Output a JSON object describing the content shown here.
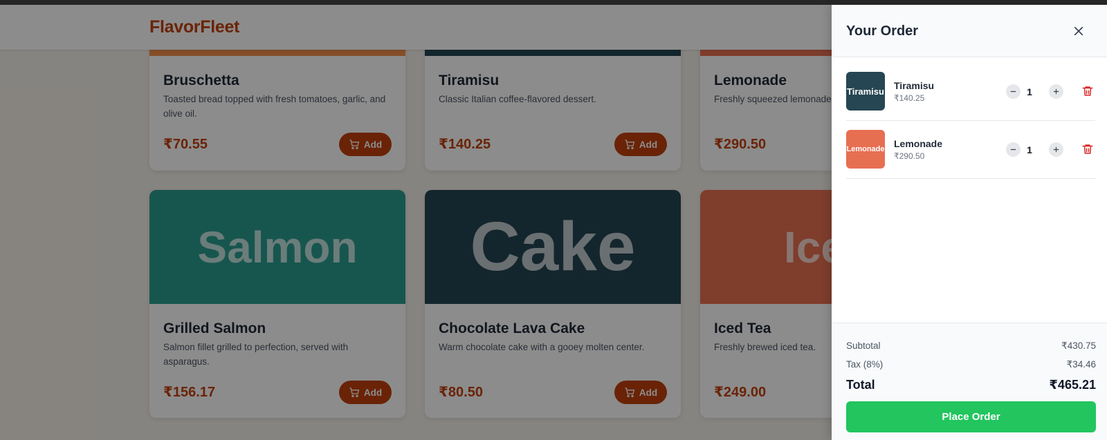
{
  "app": {
    "brand": "FlavorFleet"
  },
  "menu": {
    "add_label": "Add",
    "items": [
      {
        "name": "Bruschetta",
        "description": "Toasted bread topped with fresh tomatoes, garlic, and olive oil.",
        "price": "₹70.55",
        "image_color": "#f0904a"
      },
      {
        "name": "Tiramisu",
        "description": "Classic Italian coffee-flavored dessert.",
        "price": "₹140.25",
        "image_color": "#264653"
      },
      {
        "name": "Lemonade",
        "description": "Freshly squeezed lemonade.",
        "price": "₹290.50",
        "image_color": "#e76f51"
      },
      {
        "name": "Grilled Salmon",
        "description": "Salmon fillet grilled to perfection, served with asparagus.",
        "price": "₹156.17",
        "image_text": "Salmon",
        "image_color": "#2a9d8f"
      },
      {
        "name": "Chocolate Lava Cake",
        "description": "Warm chocolate cake with a gooey molten center.",
        "price": "₹80.50",
        "image_text": "Cake",
        "image_color": "#264653"
      },
      {
        "name": "Iced Tea",
        "description": "Freshly brewed iced tea.",
        "price": "₹249.00",
        "image_text": "Iced",
        "image_color": "#e76f51"
      }
    ]
  },
  "cart": {
    "title": "Your Order",
    "items": [
      {
        "name": "Tiramisu",
        "price": "₹140.25",
        "qty": "1",
        "thumb_text": "Tiramisu",
        "thumb_color": "#264653"
      },
      {
        "name": "Lemonade",
        "price": "₹290.50",
        "qty": "1",
        "thumb_text": "Lemonade",
        "thumb_color": "#e76f51"
      }
    ],
    "subtotal_label": "Subtotal",
    "subtotal": "₹430.75",
    "tax_label": "Tax (8%)",
    "tax": "₹34.46",
    "total_label": "Total",
    "total": "₹465.21",
    "place_order_label": "Place Order"
  },
  "colors": {
    "brand": "#c2410c",
    "place_order": "#22c55e",
    "trash": "#dc2626"
  }
}
